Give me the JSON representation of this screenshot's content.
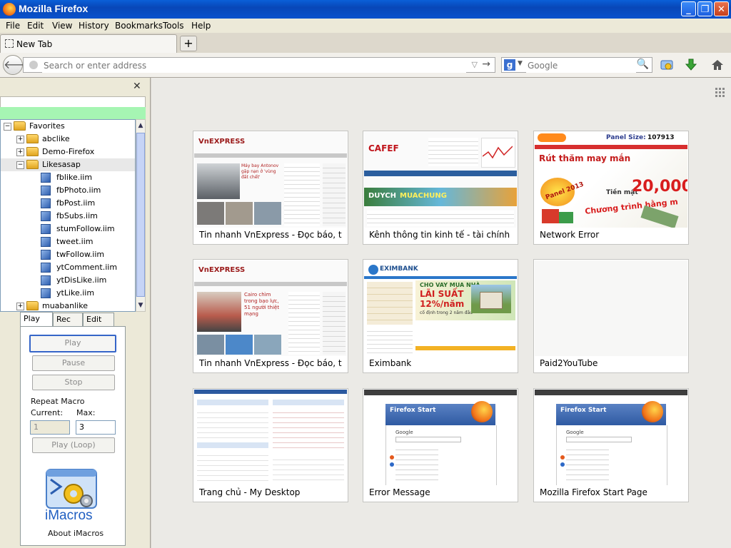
{
  "window": {
    "title": "Mozilla Firefox"
  },
  "menu": [
    "File",
    "Edit",
    "View",
    "History",
    "Bookmarks",
    "Tools",
    "Help"
  ],
  "tab": {
    "label": "New Tab"
  },
  "navbar": {
    "url_placeholder": "Search or enter address",
    "search_engine": "Google",
    "search_placeholder": "Google"
  },
  "sidebar": {
    "tree": [
      {
        "label": "Favorites",
        "type": "folder",
        "level": 0,
        "toggle": "−"
      },
      {
        "label": "abclike",
        "type": "folder",
        "level": 1,
        "toggle": "+"
      },
      {
        "label": "Demo-Firefox",
        "type": "folder",
        "level": 1,
        "toggle": "+"
      },
      {
        "label": "Likesasap",
        "type": "folder",
        "level": 1,
        "toggle": "−"
      },
      {
        "label": "fblike.iim",
        "type": "file",
        "level": 2
      },
      {
        "label": "fbPhoto.iim",
        "type": "file",
        "level": 2
      },
      {
        "label": "fbPost.iim",
        "type": "file",
        "level": 2
      },
      {
        "label": "fbSubs.iim",
        "type": "file",
        "level": 2
      },
      {
        "label": "stumFollow.iim",
        "type": "file",
        "level": 2
      },
      {
        "label": "tweet.iim",
        "type": "file",
        "level": 2
      },
      {
        "label": "twFollow.iim",
        "type": "file",
        "level": 2
      },
      {
        "label": "ytComment.iim",
        "type": "file",
        "level": 2
      },
      {
        "label": "ytDisLike.iim",
        "type": "file",
        "level": 2
      },
      {
        "label": "ytLike.iim",
        "type": "file",
        "level": 2
      },
      {
        "label": "muabanlike",
        "type": "folder",
        "level": 1,
        "toggle": "+"
      }
    ],
    "tabs": [
      "Play",
      "Rec",
      "Edit"
    ],
    "buttons": {
      "play": "Play",
      "pause": "Pause",
      "stop": "Stop",
      "play_loop": "Play (Loop)"
    },
    "repeat": {
      "title": "Repeat Macro",
      "current_label": "Current:",
      "max_label": "Max:",
      "current_value": "1",
      "max_value": "3"
    },
    "logo_text": "iMacros",
    "about": "About iMacros"
  },
  "tiles": [
    {
      "caption": "Tin nhanh VnExpress - Đọc báo, ti...",
      "kind": "vnexpress",
      "thumb_text": [
        "VnEXPRESS",
        "Máy bay Antonov gặp nạn ở 'vùng đất chết'"
      ]
    },
    {
      "caption": "Kênh thông tin kinh tế - tài chính ...",
      "kind": "cafef",
      "thumb_text": [
        "CAFEF",
        "DUYCH",
        "MUACHUNG"
      ]
    },
    {
      "caption": "Network Error",
      "kind": "pandaslive",
      "thumb_text": [
        "Panel Size:",
        "107913",
        "Rút thăm may mắn",
        "Tiền mặt",
        "20,000",
        "Chương trình hằng m",
        "Panel 2013"
      ]
    },
    {
      "caption": "Tin nhanh VnExpress - Đọc báo, ti...",
      "kind": "vnexpress2",
      "thumb_text": [
        "VnEXPRESS",
        "Cairo chìm trong bạo lực, 51 người thiệt mạng"
      ]
    },
    {
      "caption": "Eximbank",
      "kind": "eximbank",
      "thumb_text": [
        "EXIMBANK",
        "CHO VAY MUA NHÀ",
        "LÃI SUẤT",
        "12%/năm",
        "cố định trong 2 năm đầu"
      ]
    },
    {
      "caption": "Paid2YouTube",
      "kind": "blank",
      "thumb_text": []
    },
    {
      "caption": "Trang chủ - My Desktop",
      "kind": "desktop",
      "thumb_text": []
    },
    {
      "caption": "Error Message",
      "kind": "ffstart",
      "thumb_text": [
        "Firefox Start",
        "Google"
      ]
    },
    {
      "caption": "Mozilla Firefox Start Page",
      "kind": "ffstart",
      "thumb_text": [
        "Firefox Start",
        "Google"
      ]
    }
  ],
  "colors": {
    "titlebar": "#0a52cc",
    "content_bg": "#ebeae6",
    "sidebar_bg": "#ece9d8",
    "green_row": "#a6f5b3",
    "imacros_blue": "#1f5ec1"
  }
}
